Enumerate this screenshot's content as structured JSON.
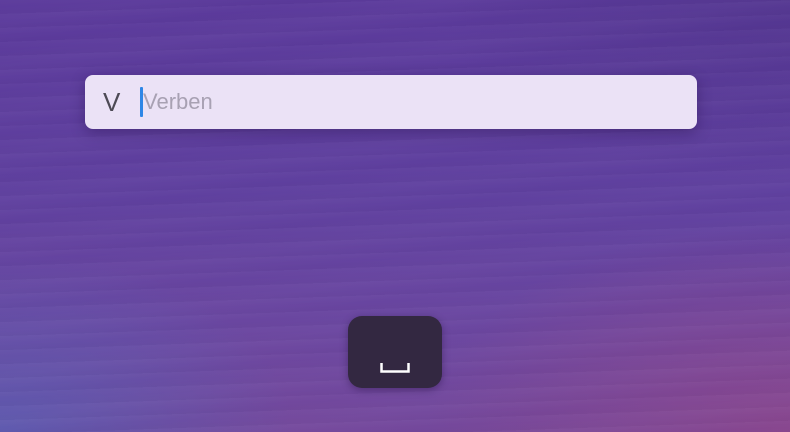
{
  "launcher": {
    "prefix": "V",
    "search": {
      "value": "",
      "placeholder": "Verben"
    },
    "key": {
      "icon": "space-bar-icon"
    }
  },
  "colors": {
    "bar_background": "#ebe2f6",
    "caret": "#2e86e6",
    "key_background": "#332841",
    "background_top": "#5b3a9b",
    "background_bottom": "#74489c"
  }
}
